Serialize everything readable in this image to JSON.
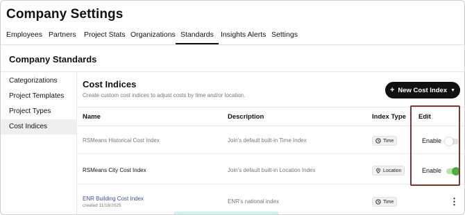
{
  "app": {
    "title": "Company Settings"
  },
  "tabs": [
    {
      "label": "Employees"
    },
    {
      "label": "Partners"
    },
    {
      "label": "Project Stats"
    },
    {
      "label": "Organizations"
    },
    {
      "label": "Standards",
      "active": true
    },
    {
      "label": "Insights Alerts"
    },
    {
      "label": "Settings"
    }
  ],
  "section": {
    "title": "Company Standards"
  },
  "sidebar": {
    "items": [
      {
        "label": "Categorizations"
      },
      {
        "label": "Project Templates"
      },
      {
        "label": "Project Types"
      },
      {
        "label": "Cost Indices",
        "active": true
      }
    ]
  },
  "cost_indices": {
    "title": "Cost Indices",
    "subtitle": "Create custom cost indices to adjust costs by time and/or location.",
    "new_button": "New Cost Index",
    "columns": {
      "name": "Name",
      "description": "Description",
      "index_type": "Index Type",
      "edit": "Edit"
    },
    "rows": [
      {
        "name": "RSMeans Historical Cost Index",
        "description": "Join's default built-in Time Index",
        "type": "Time",
        "type_icon": "clock-icon",
        "action": "Enable",
        "enabled": false
      },
      {
        "name": "RSMeans City Cost Index",
        "description": "Join's default built-in Location Index",
        "type": "Location",
        "type_icon": "location-pin-icon",
        "action": "Enable",
        "enabled": true
      },
      {
        "name": "ENR Building Cost Index",
        "created": "created 11/18/2025",
        "description": "ENR's national index",
        "type": "Time",
        "type_icon": "clock-icon",
        "action_icon": "more-vertical-icon"
      }
    ]
  },
  "colors": {
    "accent": "#111111",
    "link": "#3c4fa3",
    "toggle_on": "#4caf3f",
    "highlight_border": "#7a3b2e"
  }
}
